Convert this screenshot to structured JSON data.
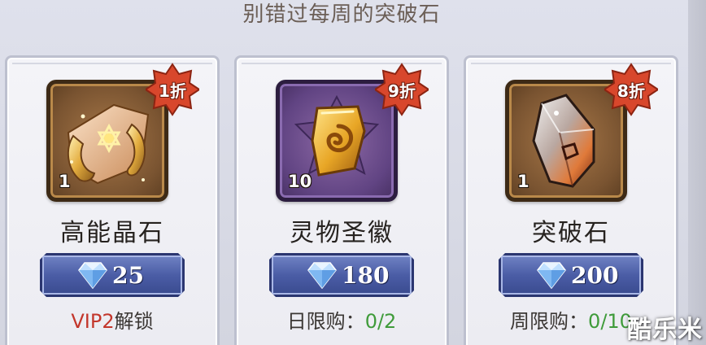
{
  "header": {
    "title": "别错过每周的突破石"
  },
  "items": [
    {
      "name": "高能晶石",
      "quantity": "1",
      "discount": "1折",
      "price": "25",
      "limit_prefix": "VIP2",
      "limit_suffix": "解锁",
      "icon": "high-energy-crystal-icon"
    },
    {
      "name": "灵物圣徽",
      "quantity": "10",
      "discount": "9折",
      "price": "180",
      "limit_label": "日限购：",
      "limit_count": "0/2",
      "icon": "spirit-emblem-icon"
    },
    {
      "name": "突破石",
      "quantity": "1",
      "discount": "8折",
      "price": "200",
      "limit_label": "周限购：",
      "limit_count": "0/10",
      "icon": "breakthrough-stone-icon"
    }
  ],
  "watermark": "酷乐米",
  "colors": {
    "discount_badge": "#d8472c",
    "price_button": "#4b5da6",
    "vip_text": "#c3362b",
    "limit_count_text": "#3f9b3a"
  },
  "currency_icon": "diamond-gem-icon"
}
